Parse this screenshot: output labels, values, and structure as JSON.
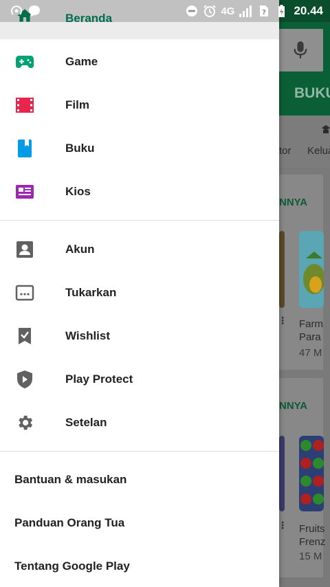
{
  "status_bar": {
    "network": "4G",
    "time": "20.44"
  },
  "drawer": {
    "primary_items": [
      {
        "label": "Beranda",
        "icon": "home-icon",
        "color": "#01875f",
        "active": true
      },
      {
        "label": "Game",
        "icon": "gamepad-icon",
        "color": "#00a173"
      },
      {
        "label": "Film",
        "icon": "film-icon",
        "color": "#e8264d"
      },
      {
        "label": "Buku",
        "icon": "book-icon",
        "color": "#039be5"
      },
      {
        "label": "Kios",
        "icon": "newsstand-icon",
        "color": "#9c27b0"
      }
    ],
    "account_items": [
      {
        "label": "Akun",
        "icon": "account-icon"
      },
      {
        "label": "Tukarkan",
        "icon": "redeem-icon"
      },
      {
        "label": "Wishlist",
        "icon": "wishlist-icon"
      },
      {
        "label": "Play Protect",
        "icon": "shield-icon"
      },
      {
        "label": "Setelan",
        "icon": "gear-icon"
      }
    ],
    "footer_items": [
      {
        "label": "Bantuan & masukan"
      },
      {
        "label": "Panduan Orang Tua"
      },
      {
        "label": "Tentang Google Play"
      }
    ],
    "icon_gray": "#616161"
  },
  "background": {
    "tab_label": "BUKU",
    "chips": [
      "tor",
      "Kelua"
    ],
    "section_more": [
      "NNYA",
      "NNYA"
    ],
    "apps": [
      {
        "title_line1": "Farm",
        "title_line2": "Para",
        "size": "47 M"
      },
      {
        "title_line1": "Fruits",
        "title_line2": "Frenz",
        "size": "15 M"
      }
    ],
    "brand_color": "#01875f"
  }
}
